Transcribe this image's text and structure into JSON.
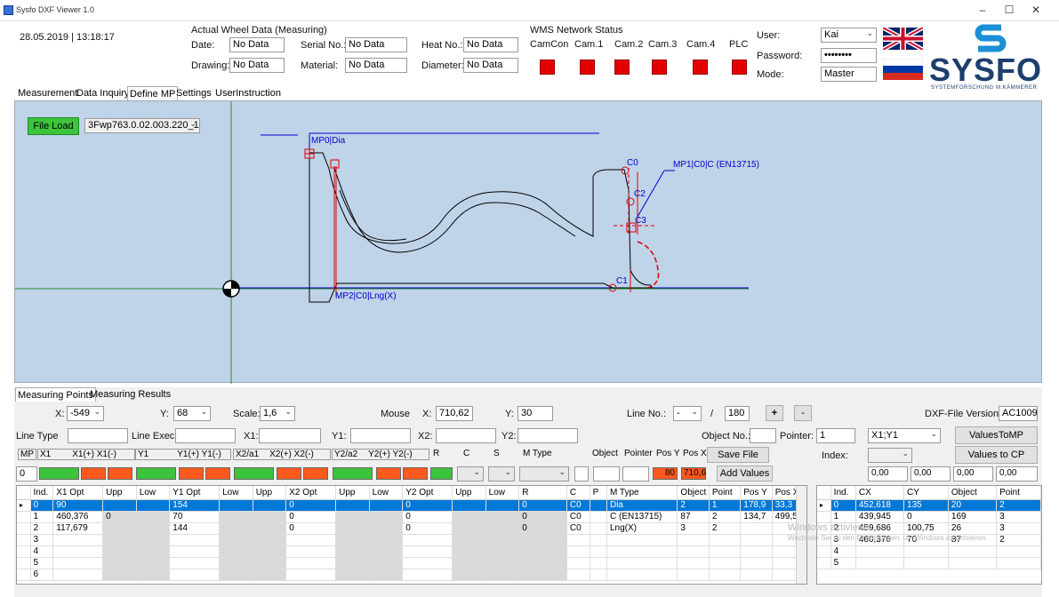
{
  "window": {
    "title": "Sysfo DXF Viewer 1.0",
    "min": "–",
    "max": "☐",
    "close": "✕"
  },
  "header": {
    "datetime": "28.05.2019 | 13:18:17",
    "wheel_title": "Actual Wheel Data (Measuring)",
    "date_label": "Date:",
    "date_value": "No Data",
    "serial_label": "Serial No.:",
    "serial_value": "No Data",
    "heat_label": "Heat No.:",
    "heat_value": "No Data",
    "drawing_label": "Drawing:",
    "drawing_value": "No Data",
    "material_label": "Material:",
    "material_value": "No Data",
    "diameter_label": "Diameter:",
    "diameter_value": "No Data",
    "wms_title": "WMS Network Status",
    "wms_items": [
      "CamCon",
      "Cam.1",
      "Cam.2",
      "Cam.3",
      "Cam.4",
      "PLC"
    ],
    "user_label": "User:",
    "user_value": "Kai",
    "password_label": "Password:",
    "password_value": "••••••••",
    "mode_label": "Mode:",
    "mode_value": "Master",
    "logo_text": "SYSFO",
    "logo_sub": "SYSTEMFORSCHUNG M.KÄMMERER"
  },
  "tabs": [
    "Measurement",
    "Data Inquiry",
    "Define MP",
    "Settings",
    "UserInstruction"
  ],
  "canvas": {
    "file_load": "File Load",
    "file_value": "3Fwp763.0.02.003.220_1",
    "labels": {
      "mp0": "MP0|Dia",
      "mp1": "MP1|C0|C (EN13715)",
      "mp2": "MP2|C0|Lng(X)",
      "c0": "C0",
      "c1": "C1",
      "c2": "C2",
      "c3": "C3"
    }
  },
  "bottom_tabs": [
    "Measuring Points",
    "Measuring Results"
  ],
  "controls": {
    "x_label": "X:",
    "x_value": "-549",
    "y_label": "Y:",
    "y_value": "68",
    "scale_label": "Scale:",
    "scale_value": "1,6",
    "mouse_label": "Mouse",
    "mouse_x_label": "X:",
    "mouse_x": "710,62",
    "mouse_y_label": "Y:",
    "mouse_y": "30",
    "line_no_label": "Line No.:",
    "line_no_value": "-",
    "line_sep": "/",
    "line_total": "180",
    "plus": "+",
    "minus": "-",
    "dxf_version_label": "DXF-File Version:",
    "dxf_version": "AC1009",
    "line_type": "Line Type",
    "line_exec": "Line Exec.",
    "x1": "X1:",
    "y1": "Y1:",
    "x2": "X2:",
    "y2": "Y2:",
    "object_no": "Object No.:",
    "pointer": "Pointer:",
    "pointer_value": "1",
    "xy_select": "X1;Y1",
    "values_to_mp": "ValuesToMP",
    "index_label": "Index:",
    "values_to_cp": "Values to CP",
    "mp_headers": [
      "MP",
      "X1",
      "X1(+)",
      "X1(-)",
      "Y1",
      "Y1(+)",
      "Y1(-)",
      "X2/a1",
      "X2(+)",
      "X2(-)",
      "Y2/a2",
      "Y2(+)",
      "Y2(-)",
      "R",
      "C",
      "S",
      "M Type",
      "Object",
      "Pointer",
      "Pos Y",
      "Pos X"
    ],
    "mp_select": "0",
    "pos_y": "80",
    "pos_x": "710,6",
    "save_file": "Save File",
    "add_values": "Add Values",
    "cp_values": [
      "0,00",
      "0,00",
      "0,00",
      "0,00"
    ]
  },
  "mp_table": {
    "headers": [
      "Ind.",
      "X1 Opt",
      "Upp",
      "Low",
      "Y1 Opt",
      "Low",
      "Upp",
      "X2 Opt",
      "Upp",
      "Low",
      "Y2 Opt",
      "Upp",
      "Low",
      "R",
      "C",
      "P",
      "M Type",
      "Object",
      "Point",
      "Pos Y",
      "Pos X"
    ],
    "rows": [
      [
        "0",
        "90",
        "",
        "",
        "154",
        "",
        "",
        "0",
        "",
        "",
        "0",
        "",
        "",
        "0",
        "C0",
        "",
        "Dia",
        "2",
        "1",
        "178,9",
        "33,3"
      ],
      [
        "1",
        "460,376",
        "0",
        "",
        "70",
        "",
        "",
        "0",
        "",
        "",
        "0",
        "",
        "",
        "0",
        "C0",
        "",
        "C (EN13715)",
        "87",
        "2",
        "134,7",
        "499,5"
      ],
      [
        "2",
        "117,679",
        "",
        "",
        "144",
        "",
        "",
        "0",
        "",
        "",
        "0",
        "",
        "",
        "0",
        "C0",
        "",
        "Lng(X)",
        "3",
        "2",
        "",
        ""
      ],
      [
        "3",
        "",
        "",
        "",
        "",
        "",
        "",
        "",
        "",
        "",
        "",
        "",
        "",
        "",
        "",
        "",
        "",
        "",
        "",
        "",
        ""
      ],
      [
        "4",
        "",
        "",
        "",
        "",
        "",
        "",
        "",
        "",
        "",
        "",
        "",
        "",
        "",
        "",
        "",
        "",
        "",
        "",
        "",
        ""
      ],
      [
        "5",
        "",
        "",
        "",
        "",
        "",
        "",
        "",
        "",
        "",
        "",
        "",
        "",
        "",
        "",
        "",
        "",
        "",
        "",
        "",
        ""
      ],
      [
        "6",
        "",
        "",
        "",
        "",
        "",
        "",
        "",
        "",
        "",
        "",
        "",
        "",
        "",
        "",
        "",
        "",
        "",
        "",
        "",
        ""
      ]
    ]
  },
  "cp_table": {
    "headers": [
      "Ind.",
      "CX",
      "CY",
      "Object",
      "Point"
    ],
    "rows": [
      [
        "0",
        "452,618",
        "135",
        "20",
        "2"
      ],
      [
        "1",
        "439,945",
        "0",
        "169",
        "3"
      ],
      [
        "2",
        "459,686",
        "100,75",
        "26",
        "3"
      ],
      [
        "3",
        "460,376",
        "70",
        "87",
        "2"
      ],
      [
        "4",
        "",
        "",
        "",
        ""
      ],
      [
        "5",
        "",
        "",
        "",
        ""
      ]
    ]
  },
  "watermark": {
    "line1": "Windows aktivieren",
    "line2": "Wechseln Sie zu den Einstellungen, um Windows zu aktivieren."
  },
  "colors": {
    "canvas_bg": "#bfd3e9",
    "status_red": "#e30000",
    "accent_blue": "#0078d7",
    "green": "#3cc43c",
    "orange": "#ff5a1e"
  }
}
